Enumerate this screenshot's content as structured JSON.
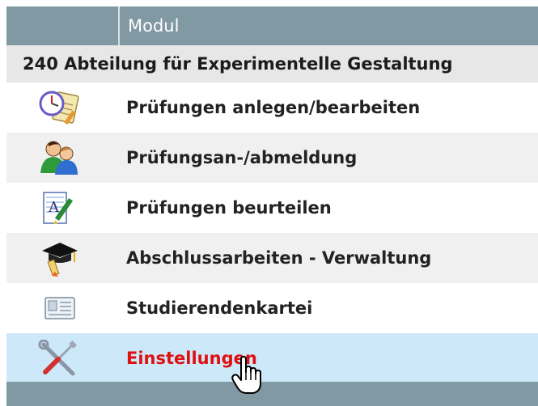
{
  "table": {
    "header": {
      "module_label": "Modul"
    },
    "section": {
      "title": "240 Abteilung für Experimentelle Gestaltung"
    },
    "rows": [
      {
        "label": "Prüfungen anlegen/bearbeiten",
        "icon": "clock-notepad-icon"
      },
      {
        "label": "Prüfungsan-/abmeldung",
        "icon": "users-icon"
      },
      {
        "label": "Prüfungen beurteilen",
        "icon": "grading-pen-icon"
      },
      {
        "label": "Abschlussarbeiten - Verwaltung",
        "icon": "graduation-cap-icon"
      },
      {
        "label": "Studierendenkartei",
        "icon": "card-file-icon"
      },
      {
        "label": "Einstellungen",
        "icon": "tools-icon",
        "state": "hover"
      }
    ]
  },
  "colors": {
    "header_bg": "#8199a3",
    "hover_bg": "#cde9f9",
    "hover_text": "#e01010"
  }
}
